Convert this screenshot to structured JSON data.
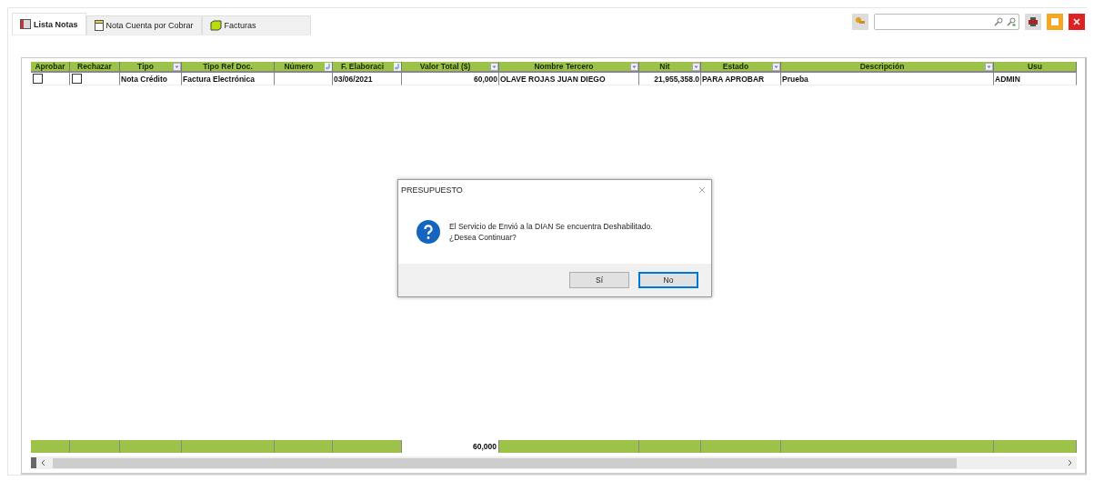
{
  "tabs": [
    {
      "label": "Lista Notas",
      "selected": true
    },
    {
      "label": "Nota Cuenta por Cobrar",
      "selected": false
    },
    {
      "label": "Facturas",
      "selected": false
    }
  ],
  "table": {
    "columns": [
      "Aprobar",
      "Rechazar",
      "Tipo",
      "Tipo Ref Doc.",
      "Número",
      "F. Elaboraci",
      "Valor Total ($)",
      "Nombre Tercero",
      "Nit",
      "Estado",
      "Descripción",
      "Usu"
    ],
    "rows": [
      {
        "cells": [
          {
            "kind": "check",
            "checked": false
          },
          {
            "kind": "check",
            "checked": false
          },
          {
            "kind": "text",
            "text": "Nota Crédito"
          },
          {
            "kind": "text",
            "text": "Factura Electrónica"
          },
          {
            "kind": "empty"
          },
          {
            "kind": "text",
            "text": "03/06/2021"
          },
          {
            "kind": "text",
            "text": "60,000"
          },
          {
            "kind": "text",
            "text": "OLAVE ROJAS JUAN DIEGO"
          },
          {
            "kind": "text",
            "text": "21,955,358.0"
          },
          {
            "kind": "text",
            "text": "PARA APROBAR"
          },
          {
            "kind": "text",
            "text": "Prueba"
          },
          {
            "kind": "text",
            "text": "ADMIN"
          }
        ]
      }
    ],
    "total_value": "60,000"
  },
  "dialog": {
    "title": "PRESUPUESTO",
    "message": "El Servicio de Envió a la DIAN Se encuentra Deshabilitado.\n¿Desea Continuar?",
    "buttons": [
      {
        "label": "Sí",
        "default": false
      },
      {
        "label": "No",
        "default": true
      }
    ]
  }
}
